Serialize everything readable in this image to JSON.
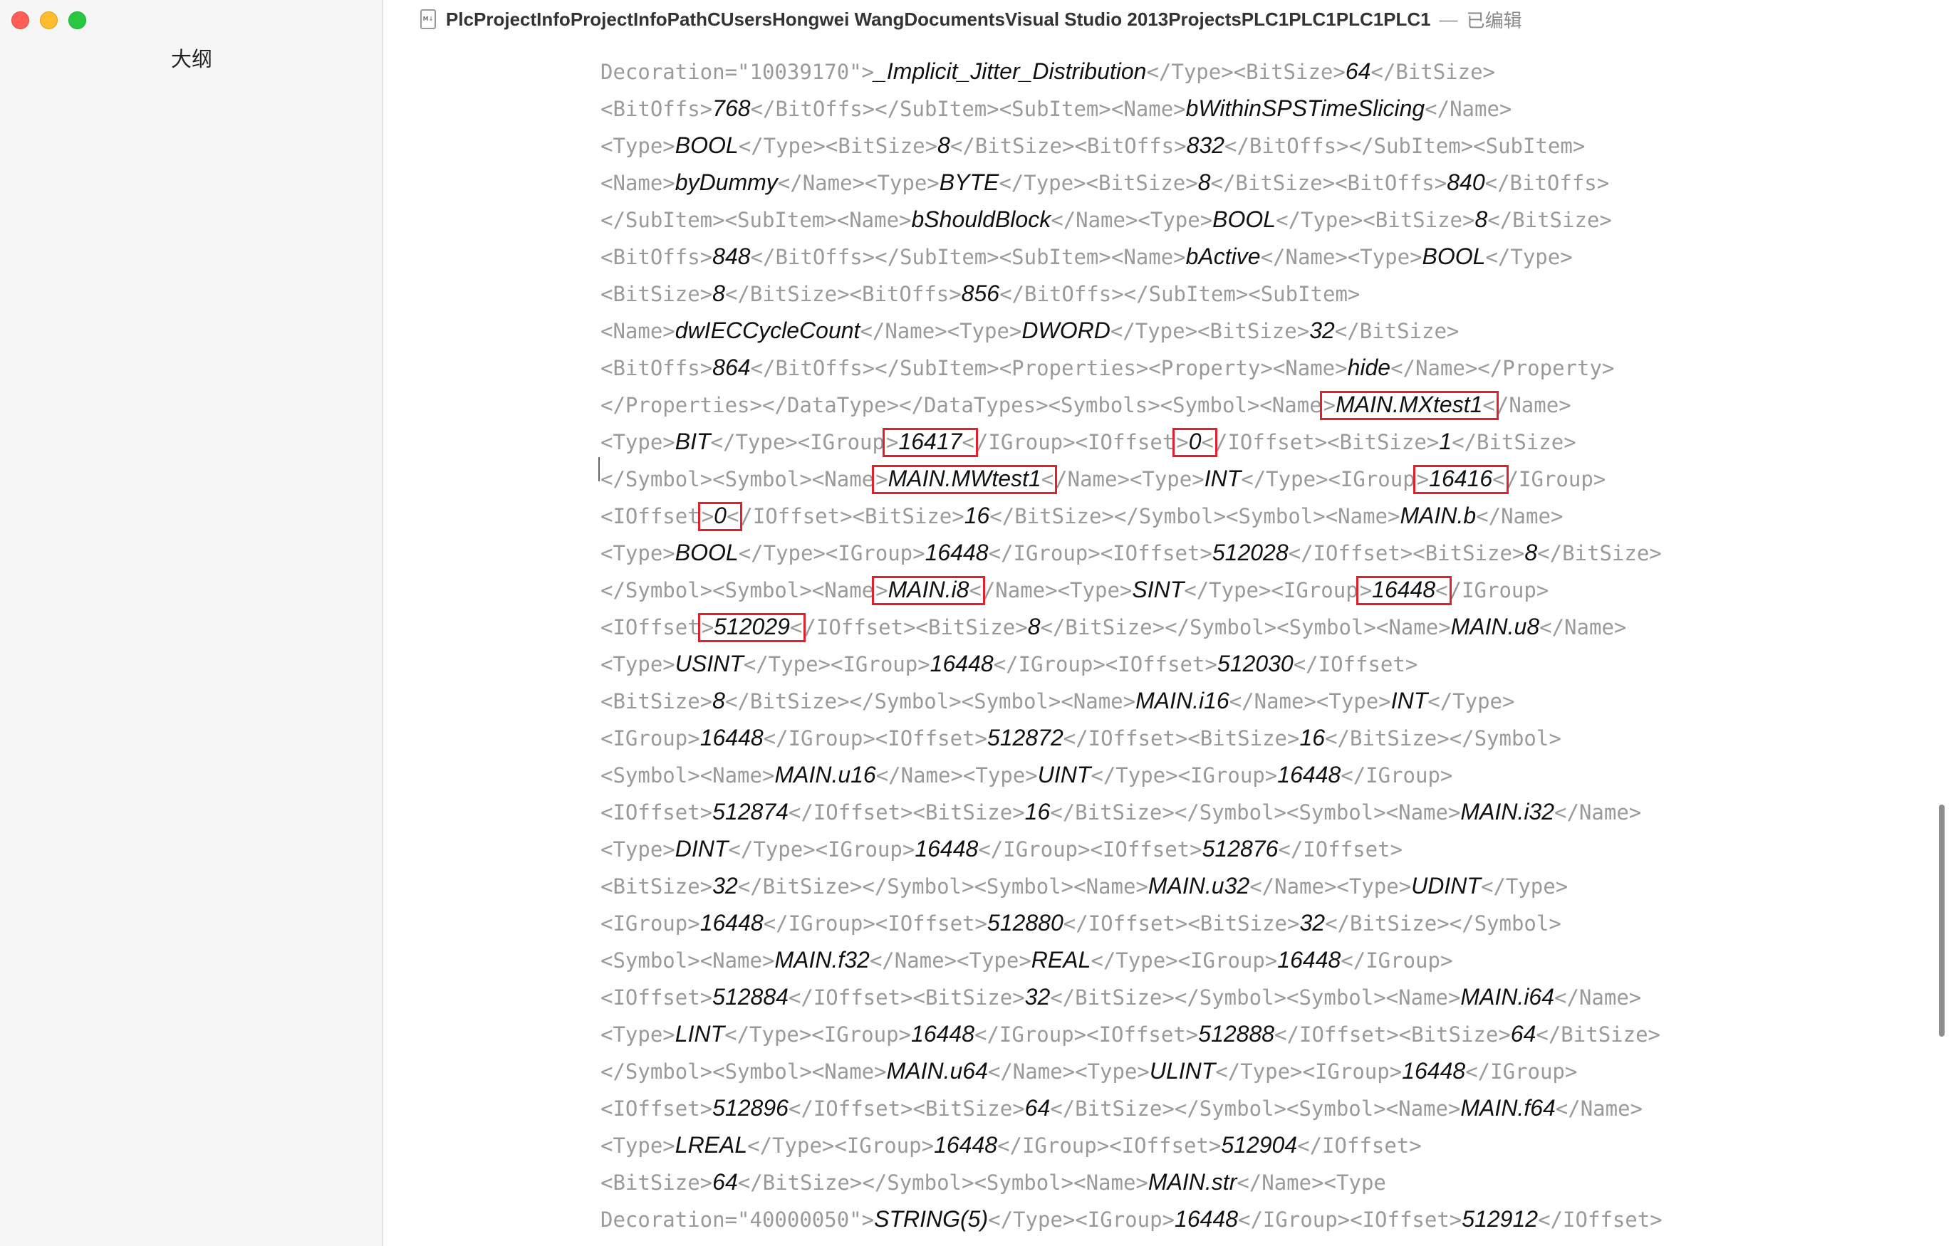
{
  "window": {
    "title": "PlcProjectInfoProjectInfoPathCUsersHongwei WangDocumentsVisual Studio 2013ProjectsPLC1PLC1PLC1PLC1",
    "separator": "—",
    "status": "已编辑",
    "doc_icon_label": "M↓"
  },
  "sidebar": {
    "title": "大纲"
  },
  "editor": {
    "lines": [
      [
        [
          "tag",
          "Decoration=\"10039170\">"
        ],
        [
          "val",
          "_Implicit_Jitter_Distribution"
        ],
        [
          "tag",
          "</Type><BitSize>"
        ],
        [
          "val",
          "64"
        ],
        [
          "tag",
          "</BitSize>"
        ]
      ],
      [
        [
          "tag",
          "<BitOffs>"
        ],
        [
          "val",
          "768"
        ],
        [
          "tag",
          "</BitOffs></SubItem><SubItem><Name>"
        ],
        [
          "val",
          "bWithinSPSTimeSlicing"
        ],
        [
          "tag",
          "</Name>"
        ]
      ],
      [
        [
          "tag",
          "<Type>"
        ],
        [
          "val",
          "BOOL"
        ],
        [
          "tag",
          "</Type><BitSize>"
        ],
        [
          "val",
          "8"
        ],
        [
          "tag",
          "</BitSize><BitOffs>"
        ],
        [
          "val",
          "832"
        ],
        [
          "tag",
          "</BitOffs></SubItem><SubItem>"
        ]
      ],
      [
        [
          "tag",
          "<Name>"
        ],
        [
          "val",
          "byDummy"
        ],
        [
          "tag",
          "</Name><Type>"
        ],
        [
          "val",
          "BYTE"
        ],
        [
          "tag",
          "</Type><BitSize>"
        ],
        [
          "val",
          "8"
        ],
        [
          "tag",
          "</BitSize><BitOffs>"
        ],
        [
          "val",
          "840"
        ],
        [
          "tag",
          "</BitOffs>"
        ]
      ],
      [
        [
          "tag",
          "</SubItem><SubItem><Name>"
        ],
        [
          "val",
          "bShouldBlock"
        ],
        [
          "tag",
          "</Name><Type>"
        ],
        [
          "val",
          "BOOL"
        ],
        [
          "tag",
          "</Type><BitSize>"
        ],
        [
          "val",
          "8"
        ],
        [
          "tag",
          "</BitSize>"
        ]
      ],
      [
        [
          "tag",
          "<BitOffs>"
        ],
        [
          "val",
          "848"
        ],
        [
          "tag",
          "</BitOffs></SubItem><SubItem><Name>"
        ],
        [
          "val",
          "bActive"
        ],
        [
          "tag",
          "</Name><Type>"
        ],
        [
          "val",
          "BOOL"
        ],
        [
          "tag",
          "</Type>"
        ]
      ],
      [
        [
          "tag",
          "<BitSize>"
        ],
        [
          "val",
          "8"
        ],
        [
          "tag",
          "</BitSize><BitOffs>"
        ],
        [
          "val",
          "856"
        ],
        [
          "tag",
          "</BitOffs></SubItem><SubItem>"
        ]
      ],
      [
        [
          "tag",
          "<Name>"
        ],
        [
          "val",
          "dwIECCycleCount"
        ],
        [
          "tag",
          "</Name><Type>"
        ],
        [
          "val",
          "DWORD"
        ],
        [
          "tag",
          "</Type><BitSize>"
        ],
        [
          "val",
          "32"
        ],
        [
          "tag",
          "</BitSize>"
        ]
      ],
      [
        [
          "tag",
          "<BitOffs>"
        ],
        [
          "val",
          "864"
        ],
        [
          "tag",
          "</BitOffs></SubItem><Properties><Property><Name>"
        ],
        [
          "val",
          "hide"
        ],
        [
          "tag",
          "</Name></Property>"
        ]
      ],
      [
        [
          "tag",
          "</Properties></DataType></DataTypes><Symbols><Symbol><Name"
        ],
        [
          "hl",
          "[tag]>|[val]MAIN.MXtest1|[tag]<"
        ],
        [
          "tag",
          "/Name>"
        ]
      ],
      [
        [
          "tag",
          "<Type>"
        ],
        [
          "val",
          "BIT"
        ],
        [
          "tag",
          "</Type><IGroup"
        ],
        [
          "hl",
          "[tag]>|[val]16417|[tag]<"
        ],
        [
          "tag",
          "/IGroup><IOffset"
        ],
        [
          "hl",
          "[tag]>|[val]0|[tag]<"
        ],
        [
          "tag",
          "/IOffset><BitSize>"
        ],
        [
          "val",
          "1"
        ],
        [
          "tag",
          "</BitSize>"
        ]
      ],
      [
        [
          "tag",
          "</Symbol><Symbol><Name"
        ],
        [
          "hl",
          "[tag]>|[val]MAIN.MWtest1|[tag]<"
        ],
        [
          "tag",
          "/Name><Type>"
        ],
        [
          "val",
          "INT"
        ],
        [
          "tag",
          "</Type><IGroup"
        ],
        [
          "hl",
          "[tag]>|[val]16416|[tag]<"
        ],
        [
          "tag",
          "/IGroup>"
        ]
      ],
      [
        [
          "tag",
          "<IOffset"
        ],
        [
          "hl",
          "[tag]>|[val]0|[tag]<"
        ],
        [
          "tag",
          "/IOffset><BitSize>"
        ],
        [
          "val",
          "16"
        ],
        [
          "tag",
          "</BitSize></Symbol><Symbol><Name>"
        ],
        [
          "val",
          "MAIN.b"
        ],
        [
          "tag",
          "</Name>"
        ]
      ],
      [
        [
          "tag",
          "<Type>"
        ],
        [
          "val",
          "BOOL"
        ],
        [
          "tag",
          "</Type><IGroup>"
        ],
        [
          "val",
          "16448"
        ],
        [
          "tag",
          "</IGroup><IOffset>"
        ],
        [
          "val",
          "512028"
        ],
        [
          "tag",
          "</IOffset><BitSize>"
        ],
        [
          "val",
          "8"
        ],
        [
          "tag",
          "</BitSize>"
        ]
      ],
      [
        [
          "tag",
          "</Symbol><Symbol><Name"
        ],
        [
          "hl",
          "[tag]>|[val]MAIN.i8|[tag]<"
        ],
        [
          "tag",
          "/Name><Type>"
        ],
        [
          "val",
          "SINT"
        ],
        [
          "tag",
          "</Type><IGroup"
        ],
        [
          "hl",
          "[tag]>|[val]16448|[tag]<"
        ],
        [
          "tag",
          "/IGroup>"
        ]
      ],
      [
        [
          "tag",
          "<IOffset"
        ],
        [
          "hl",
          "[tag]>|[val]512029|[tag]<"
        ],
        [
          "tag",
          "/IOffset><BitSize>"
        ],
        [
          "val",
          "8"
        ],
        [
          "tag",
          "</BitSize></Symbol><Symbol><Name>"
        ],
        [
          "val",
          "MAIN.u8"
        ],
        [
          "tag",
          "</Name>"
        ]
      ],
      [
        [
          "tag",
          "<Type>"
        ],
        [
          "val",
          "USINT"
        ],
        [
          "tag",
          "</Type><IGroup>"
        ],
        [
          "val",
          "16448"
        ],
        [
          "tag",
          "</IGroup><IOffset>"
        ],
        [
          "val",
          "512030"
        ],
        [
          "tag",
          "</IOffset>"
        ]
      ],
      [
        [
          "tag",
          "<BitSize>"
        ],
        [
          "val",
          "8"
        ],
        [
          "tag",
          "</BitSize></Symbol><Symbol><Name>"
        ],
        [
          "val",
          "MAIN.i16"
        ],
        [
          "tag",
          "</Name><Type>"
        ],
        [
          "val",
          "INT"
        ],
        [
          "tag",
          "</Type>"
        ]
      ],
      [
        [
          "tag",
          "<IGroup>"
        ],
        [
          "val",
          "16448"
        ],
        [
          "tag",
          "</IGroup><IOffset>"
        ],
        [
          "val",
          "512872"
        ],
        [
          "tag",
          "</IOffset><BitSize>"
        ],
        [
          "val",
          "16"
        ],
        [
          "tag",
          "</BitSize></Symbol>"
        ]
      ],
      [
        [
          "tag",
          "<Symbol><Name>"
        ],
        [
          "val",
          "MAIN.u16"
        ],
        [
          "tag",
          "</Name><Type>"
        ],
        [
          "val",
          "UINT"
        ],
        [
          "tag",
          "</Type><IGroup>"
        ],
        [
          "val",
          "16448"
        ],
        [
          "tag",
          "</IGroup>"
        ]
      ],
      [
        [
          "tag",
          "<IOffset>"
        ],
        [
          "val",
          "512874"
        ],
        [
          "tag",
          "</IOffset><BitSize>"
        ],
        [
          "val",
          "16"
        ],
        [
          "tag",
          "</BitSize></Symbol><Symbol><Name>"
        ],
        [
          "val",
          "MAIN.i32"
        ],
        [
          "tag",
          "</Name>"
        ]
      ],
      [
        [
          "tag",
          "<Type>"
        ],
        [
          "val",
          "DINT"
        ],
        [
          "tag",
          "</Type><IGroup>"
        ],
        [
          "val",
          "16448"
        ],
        [
          "tag",
          "</IGroup><IOffset>"
        ],
        [
          "val",
          "512876"
        ],
        [
          "tag",
          "</IOffset>"
        ]
      ],
      [
        [
          "tag",
          "<BitSize>"
        ],
        [
          "val",
          "32"
        ],
        [
          "tag",
          "</BitSize></Symbol><Symbol><Name>"
        ],
        [
          "val",
          "MAIN.u32"
        ],
        [
          "tag",
          "</Name><Type>"
        ],
        [
          "val",
          "UDINT"
        ],
        [
          "tag",
          "</Type>"
        ]
      ],
      [
        [
          "tag",
          "<IGroup>"
        ],
        [
          "val",
          "16448"
        ],
        [
          "tag",
          "</IGroup><IOffset>"
        ],
        [
          "val",
          "512880"
        ],
        [
          "tag",
          "</IOffset><BitSize>"
        ],
        [
          "val",
          "32"
        ],
        [
          "tag",
          "</BitSize></Symbol>"
        ]
      ],
      [
        [
          "tag",
          "<Symbol><Name>"
        ],
        [
          "val",
          "MAIN.f32"
        ],
        [
          "tag",
          "</Name><Type>"
        ],
        [
          "val",
          "REAL"
        ],
        [
          "tag",
          "</Type><IGroup>"
        ],
        [
          "val",
          "16448"
        ],
        [
          "tag",
          "</IGroup>"
        ]
      ],
      [
        [
          "tag",
          "<IOffset>"
        ],
        [
          "val",
          "512884"
        ],
        [
          "tag",
          "</IOffset><BitSize>"
        ],
        [
          "val",
          "32"
        ],
        [
          "tag",
          "</BitSize></Symbol><Symbol><Name>"
        ],
        [
          "val",
          "MAIN.i64"
        ],
        [
          "tag",
          "</Name>"
        ]
      ],
      [
        [
          "tag",
          "<Type>"
        ],
        [
          "val",
          "LINT"
        ],
        [
          "tag",
          "</Type><IGroup>"
        ],
        [
          "val",
          "16448"
        ],
        [
          "tag",
          "</IGroup><IOffset>"
        ],
        [
          "val",
          "512888"
        ],
        [
          "tag",
          "</IOffset><BitSize>"
        ],
        [
          "val",
          "64"
        ],
        [
          "tag",
          "</BitSize>"
        ]
      ],
      [
        [
          "tag",
          "</Symbol><Symbol><Name>"
        ],
        [
          "val",
          "MAIN.u64"
        ],
        [
          "tag",
          "</Name><Type>"
        ],
        [
          "val",
          "ULINT"
        ],
        [
          "tag",
          "</Type><IGroup>"
        ],
        [
          "val",
          "16448"
        ],
        [
          "tag",
          "</IGroup>"
        ]
      ],
      [
        [
          "tag",
          "<IOffset>"
        ],
        [
          "val",
          "512896"
        ],
        [
          "tag",
          "</IOffset><BitSize>"
        ],
        [
          "val",
          "64"
        ],
        [
          "tag",
          "</BitSize></Symbol><Symbol><Name>"
        ],
        [
          "val",
          "MAIN.f64"
        ],
        [
          "tag",
          "</Name>"
        ]
      ],
      [
        [
          "tag",
          "<Type>"
        ],
        [
          "val",
          "LREAL"
        ],
        [
          "tag",
          "</Type><IGroup>"
        ],
        [
          "val",
          "16448"
        ],
        [
          "tag",
          "</IGroup><IOffset>"
        ],
        [
          "val",
          "512904"
        ],
        [
          "tag",
          "</IOffset>"
        ]
      ],
      [
        [
          "tag",
          "<BitSize>"
        ],
        [
          "val",
          "64"
        ],
        [
          "tag",
          "</BitSize></Symbol><Symbol><Name>"
        ],
        [
          "val",
          "MAIN.str"
        ],
        [
          "tag",
          "</Name><Type"
        ]
      ],
      [
        [
          "tag",
          "Decoration=\"40000050\">"
        ],
        [
          "val",
          "STRING(5)"
        ],
        [
          "tag",
          "</Type><IGroup>"
        ],
        [
          "val",
          "16448"
        ],
        [
          "tag",
          "</IGroup><IOffset>"
        ],
        [
          "val",
          "512912"
        ],
        [
          "tag",
          "</IOffset>"
        ]
      ]
    ]
  },
  "colors": {
    "highlight_box": "#e0202a",
    "tag_text": "#9a9a9a",
    "value_text": "#111111"
  },
  "icons": [
    "close-traffic-light",
    "minimize-traffic-light",
    "zoom-traffic-light",
    "markdown-document-icon"
  ]
}
